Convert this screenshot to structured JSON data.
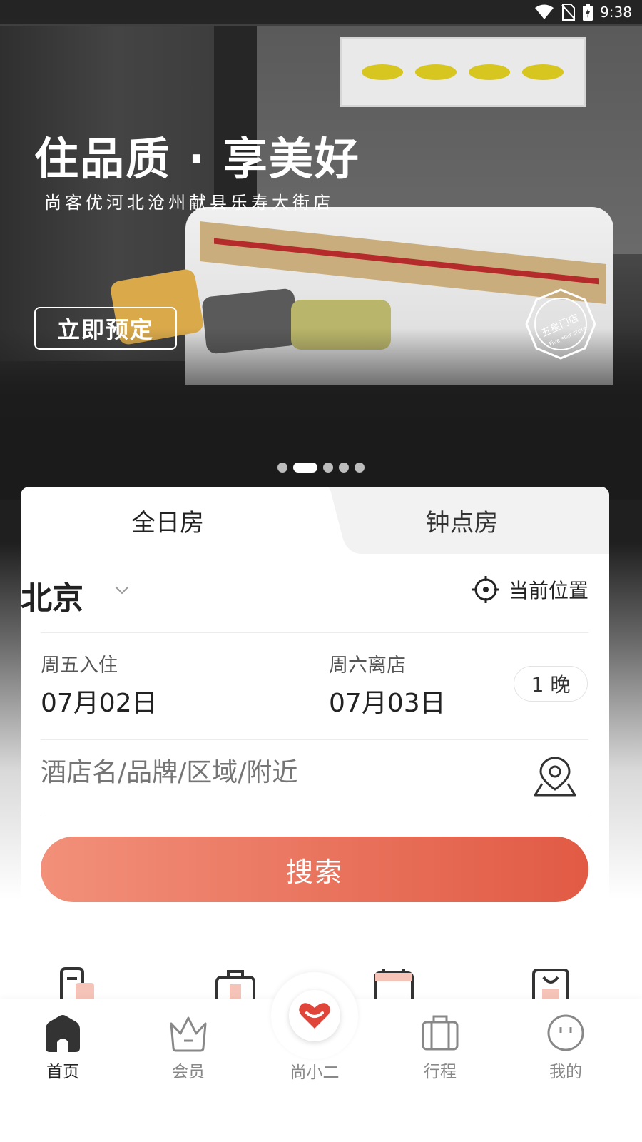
{
  "status_bar": {
    "time": "9:38"
  },
  "banner": {
    "headline": "住品质 · 享美好",
    "subline": "尚客优河北沧州献县乐寿大街店",
    "book_button": "立即预定",
    "seal_text": "五星门店",
    "seal_subtext": "Five star store",
    "carousel_count": 5,
    "carousel_active_index": 1
  },
  "booking": {
    "tabs": [
      {
        "label": "全日房",
        "active": true
      },
      {
        "label": "钟点房",
        "active": false
      }
    ],
    "city": "北京",
    "current_location_label": "当前位置",
    "checkin": {
      "label": "周五入住",
      "date": "07月02日"
    },
    "checkout": {
      "label": "周六离店",
      "date": "07月03日"
    },
    "nights": "1 晚",
    "search_placeholder": "酒店名/品牌/区域/附近",
    "search_button": "搜索"
  },
  "tab_bar": {
    "items": [
      {
        "label": "首页",
        "icon": "home-icon",
        "active": true
      },
      {
        "label": "会员",
        "icon": "crown-icon",
        "active": false
      },
      {
        "label": "尚小二",
        "icon": "heart-icon",
        "active": false
      },
      {
        "label": "行程",
        "icon": "suitcase-icon",
        "active": false
      },
      {
        "label": "我的",
        "icon": "profile-icon",
        "active": false
      }
    ]
  },
  "colors": {
    "accent": "#e15a44",
    "accent_light": "#f2907a",
    "text_dark": "#222222",
    "placeholder": "#b3b3b3"
  }
}
